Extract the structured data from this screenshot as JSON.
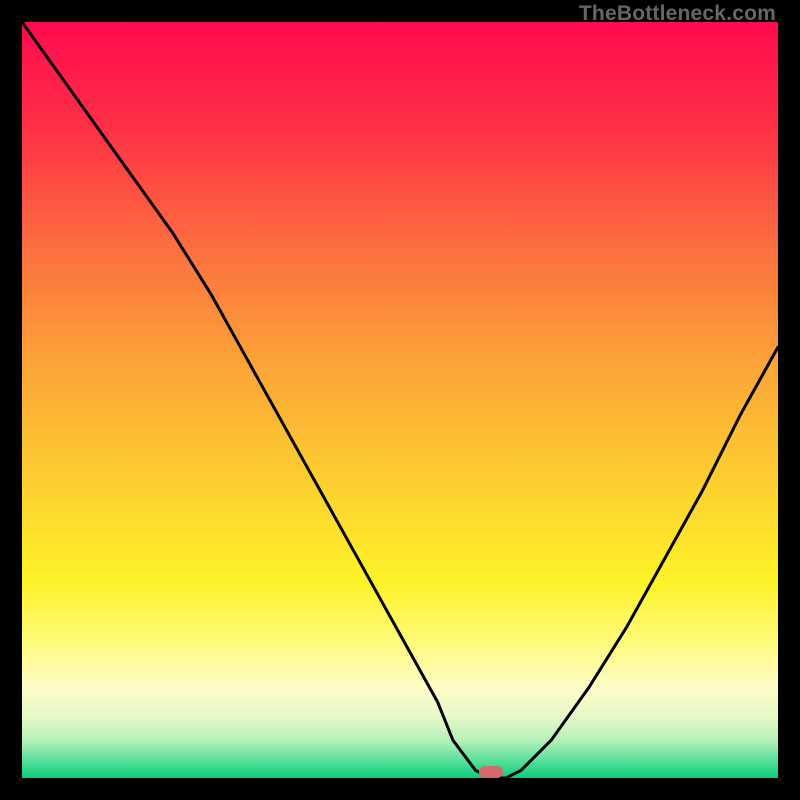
{
  "watermark": "TheBottleneck.com",
  "chart_data": {
    "type": "line",
    "title": "",
    "xlabel": "",
    "ylabel": "",
    "xlim": [
      0,
      100
    ],
    "ylim": [
      0,
      100
    ],
    "series": [
      {
        "name": "bottleneck-curve",
        "x": [
          0,
          5,
          10,
          15,
          20,
          25,
          30,
          35,
          40,
          45,
          50,
          55,
          57,
          60,
          62,
          64,
          66,
          70,
          75,
          80,
          85,
          90,
          95,
          100
        ],
        "y": [
          100,
          93,
          86,
          79,
          72,
          64,
          55,
          46,
          37,
          28,
          19,
          10,
          5,
          1,
          0,
          0,
          1,
          5,
          12,
          20,
          29,
          38,
          48,
          57
        ]
      }
    ],
    "gradient_stops": [
      {
        "pct": 0,
        "color": "#ff0a4f"
      },
      {
        "pct": 14,
        "color": "#ff3046"
      },
      {
        "pct": 30,
        "color": "#fd6f3f"
      },
      {
        "pct": 46,
        "color": "#fba637"
      },
      {
        "pct": 62,
        "color": "#fdd22f"
      },
      {
        "pct": 74,
        "color": "#fef229"
      },
      {
        "pct": 82,
        "color": "#fefb7a"
      },
      {
        "pct": 88,
        "color": "#fdfdc6"
      },
      {
        "pct": 92,
        "color": "#e5f8c8"
      },
      {
        "pct": 95,
        "color": "#b6f0b9"
      },
      {
        "pct": 97.5,
        "color": "#5fe19e"
      },
      {
        "pct": 100,
        "color": "#09ce7b"
      }
    ],
    "marker": {
      "name": "optimal-point",
      "x": 62,
      "y": 0,
      "color": "#d46a6a",
      "width_pct": 3.2,
      "height_pct": 1.6
    }
  }
}
